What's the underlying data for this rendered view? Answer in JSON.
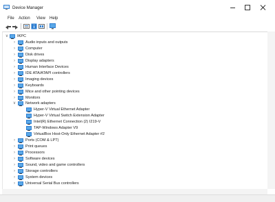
{
  "window": {
    "title": "Device Manager"
  },
  "menu": [
    "File",
    "Action",
    "View",
    "Help"
  ],
  "toolbar": {
    "buttons": [
      "back-icon",
      "forward-icon",
      "properties-icon",
      "help-icon",
      "update-driver-icon",
      "monitor-icon"
    ]
  },
  "tree": {
    "root": "IKPC",
    "categories": [
      {
        "label": "Audio inputs and outputs",
        "icon": "speaker-icon",
        "expanded": false
      },
      {
        "label": "Computer",
        "icon": "computer-icon",
        "expanded": false
      },
      {
        "label": "Disk drives",
        "icon": "disk-drive-icon",
        "expanded": false
      },
      {
        "label": "Display adapters",
        "icon": "display-adapter-icon",
        "expanded": false
      },
      {
        "label": "Human Interface Devices",
        "icon": "hid-icon",
        "expanded": false
      },
      {
        "label": "IDE ATA/ATAPI controllers",
        "icon": "ide-controller-icon",
        "expanded": false
      },
      {
        "label": "Imaging devices",
        "icon": "camera-icon",
        "expanded": false
      },
      {
        "label": "Keyboards",
        "icon": "keyboard-icon",
        "expanded": false
      },
      {
        "label": "Mice and other pointing devices",
        "icon": "mouse-icon",
        "expanded": false
      },
      {
        "label": "Monitors",
        "icon": "monitor-icon",
        "expanded": false
      },
      {
        "label": "Network adapters",
        "icon": "network-adapter-icon",
        "expanded": true,
        "children": [
          "Hyper-V Virtual Ethernet Adapter",
          "Hyper-V Virtual Switch Extension Adapter",
          "Intel(R) Ethernet Connection (2) I219-V",
          "TAP-Windows Adapter V9",
          "VirtualBox Host-Only Ethernet Adapter #2"
        ]
      },
      {
        "label": "Ports (COM & LPT)",
        "icon": "port-icon",
        "expanded": false
      },
      {
        "label": "Print queues",
        "icon": "printer-icon",
        "expanded": false
      },
      {
        "label": "Processors",
        "icon": "processor-icon",
        "expanded": false
      },
      {
        "label": "Software devices",
        "icon": "software-device-icon",
        "expanded": false
      },
      {
        "label": "Sound, video and game controllers",
        "icon": "sound-icon",
        "expanded": false
      },
      {
        "label": "Storage controllers",
        "icon": "storage-controller-icon",
        "expanded": false
      },
      {
        "label": "System devices",
        "icon": "system-device-icon",
        "expanded": false
      },
      {
        "label": "Universal Serial Bus controllers",
        "icon": "usb-icon",
        "expanded": false
      }
    ]
  },
  "colors": {
    "icon_blue": "#2f7fd1",
    "icon_gray": "#6d6d6d",
    "icon_dark": "#3c3c3c",
    "tree_lines": "#d9d9d9"
  }
}
